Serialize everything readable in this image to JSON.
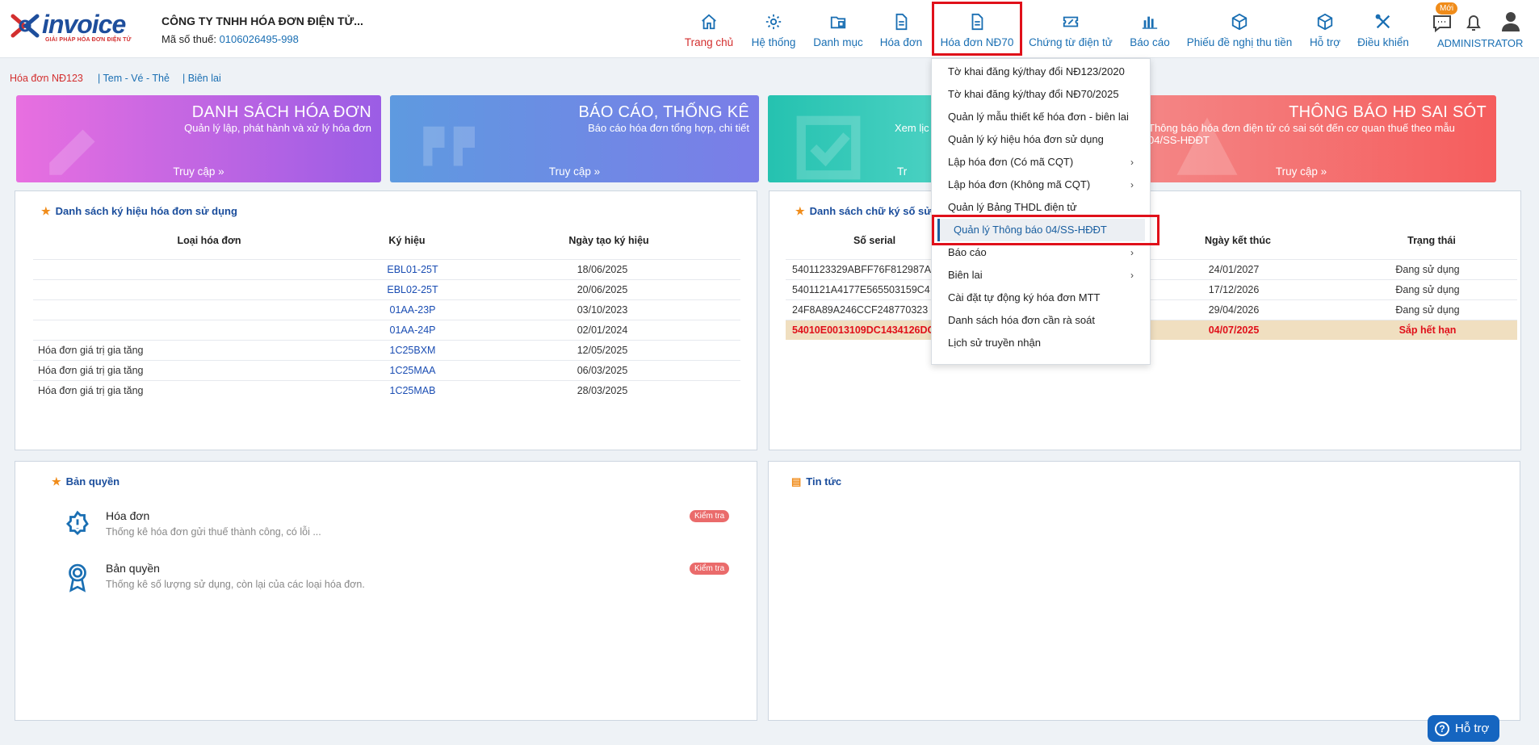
{
  "brand": {
    "logo_text": "invoice",
    "logo_tagline": "GIẢI PHÁP HÓA ĐƠN ĐIỆN TỬ"
  },
  "company": {
    "name": "CÔNG TY TNHH HÓA ĐƠN ĐIỆN TỬ...",
    "tax_label": "Mã số thuế:",
    "tax_code": "0106026495-998"
  },
  "nav": [
    {
      "label": "Trang chủ",
      "icon": "home-icon"
    },
    {
      "label": "Hệ thống",
      "icon": "gear-icon"
    },
    {
      "label": "Danh mục",
      "icon": "folder-icon"
    },
    {
      "label": "Hóa đơn",
      "icon": "document-icon"
    },
    {
      "label": "Hóa đơn NĐ70",
      "icon": "document-icon"
    },
    {
      "label": "Chứng từ điện tử",
      "icon": "ticket-icon"
    },
    {
      "label": "Báo cáo",
      "icon": "bar-chart-icon"
    },
    {
      "label": "Phiếu đề nghị thu tiền",
      "icon": "cube-icon"
    },
    {
      "label": "Hỗ trợ",
      "icon": "cube-icon"
    },
    {
      "label": "Điều khiển",
      "icon": "tools-icon"
    }
  ],
  "topright": {
    "new_badge": "Mới",
    "user": "ADMINISTRATOR"
  },
  "dropdown": [
    {
      "label": "Tờ khai đăng ký/thay đổi NĐ123/2020",
      "sub": ""
    },
    {
      "label": "Tờ khai đăng ký/thay đổi NĐ70/2025",
      "sub": ""
    },
    {
      "label": "Quản lý mẫu thiết kế hóa đơn - biên lai",
      "sub": ""
    },
    {
      "label": "Quản lý ký hiệu hóa đơn sử dụng",
      "sub": ""
    },
    {
      "label": "Lập hóa đơn (Có mã CQT)",
      "sub": "›"
    },
    {
      "label": "Lập hóa đơn (Không mã CQT)",
      "sub": "›"
    },
    {
      "label": "Quản lý Bảng THDL điện tử",
      "sub": ""
    },
    {
      "label": "Quản lý Thông báo 04/SS-HĐĐT",
      "sub": ""
    },
    {
      "label": "Báo cáo",
      "sub": "›"
    },
    {
      "label": "Biên lai",
      "sub": "›"
    },
    {
      "label": "Cài đặt tự động ký hóa đơn MTT",
      "sub": ""
    },
    {
      "label": "Danh sách hóa đơn cần rà soát",
      "sub": ""
    },
    {
      "label": "Lịch sử truyền nhận",
      "sub": ""
    }
  ],
  "subnav": [
    "Hóa đơn NĐ123",
    "| Tem - Vé - Thẻ",
    "| Biên lai"
  ],
  "banners": [
    {
      "title": "DANH SÁCH HÓA ĐƠN",
      "desc": "Quản lý lập, phát hành và xử lý hóa đơn",
      "link": "Truy cập",
      "color": "#c566e0"
    },
    {
      "title": "BÁO CÁO, THỐNG KÊ",
      "desc": "Báo cáo hóa đơn tổng hợp, chi tiết",
      "link": "Truy cập",
      "color": "#6f8ee6"
    },
    {
      "title": "",
      "desc": "Xem lịc",
      "link": "Tr",
      "color": "#35c6b5"
    },
    {
      "title": "THÔNG BÁO HĐ SAI SÓT",
      "desc": "Thông báo hóa đơn điện tử có sai sót đến cơ quan thuế theo mẫu 04/SS-HĐĐT",
      "link": "Truy cập",
      "color": "#f26d6d"
    }
  ],
  "symbols_panel": {
    "title": "Danh sách ký hiệu hóa đơn sử dụng",
    "headers": [
      "Loại hóa đơn",
      "Ký hiệu",
      "Ngày tạo ký hiệu"
    ],
    "rows": [
      [
        "",
        "EBL01-25T",
        "18/06/2025"
      ],
      [
        "",
        "EBL02-25T",
        "20/06/2025"
      ],
      [
        "",
        "01AA-23P",
        "03/10/2023"
      ],
      [
        "",
        "01AA-24P",
        "02/01/2024"
      ],
      [
        "Hóa đơn giá trị gia tăng",
        "1C25BXM",
        "12/05/2025"
      ],
      [
        "Hóa đơn giá trị gia tăng",
        "1C25MAA",
        "06/03/2025"
      ],
      [
        "Hóa đơn giá trị gia tăng",
        "1C25MAB",
        "28/03/2025"
      ]
    ]
  },
  "certs_panel": {
    "title": "Danh sách chữ ký số sử",
    "headers": [
      "Số serial",
      "Ngày kết thúc",
      "Trạng thái"
    ],
    "rows": [
      [
        "5401123329ABFF76F812987A",
        "24/01/2027",
        "Đang sử dụng"
      ],
      [
        "5401121A4177E565503159C4",
        "17/12/2026",
        "Đang sử dụng"
      ],
      [
        "24F8A89A246CCF248770323",
        "29/04/2026",
        "Đang sử dụng"
      ],
      [
        "54010E0013109DC1434126DC",
        "04/07/2025",
        "Sắp hết hạn"
      ]
    ]
  },
  "license_panel": {
    "title": "Bản quyền",
    "items": [
      {
        "title": "Hóa đơn",
        "desc": "Thống kê hóa đơn gửi thuế thành công, có lỗi ...",
        "badge": "Kiểm tra"
      },
      {
        "title": "Bản quyền",
        "desc": "Thống kê số lượng sử dụng, còn lại của các loại hóa đơn.",
        "badge": "Kiểm tra"
      }
    ]
  },
  "news_panel": {
    "title": "Tin tức"
  },
  "help_button": "Hỗ trợ"
}
